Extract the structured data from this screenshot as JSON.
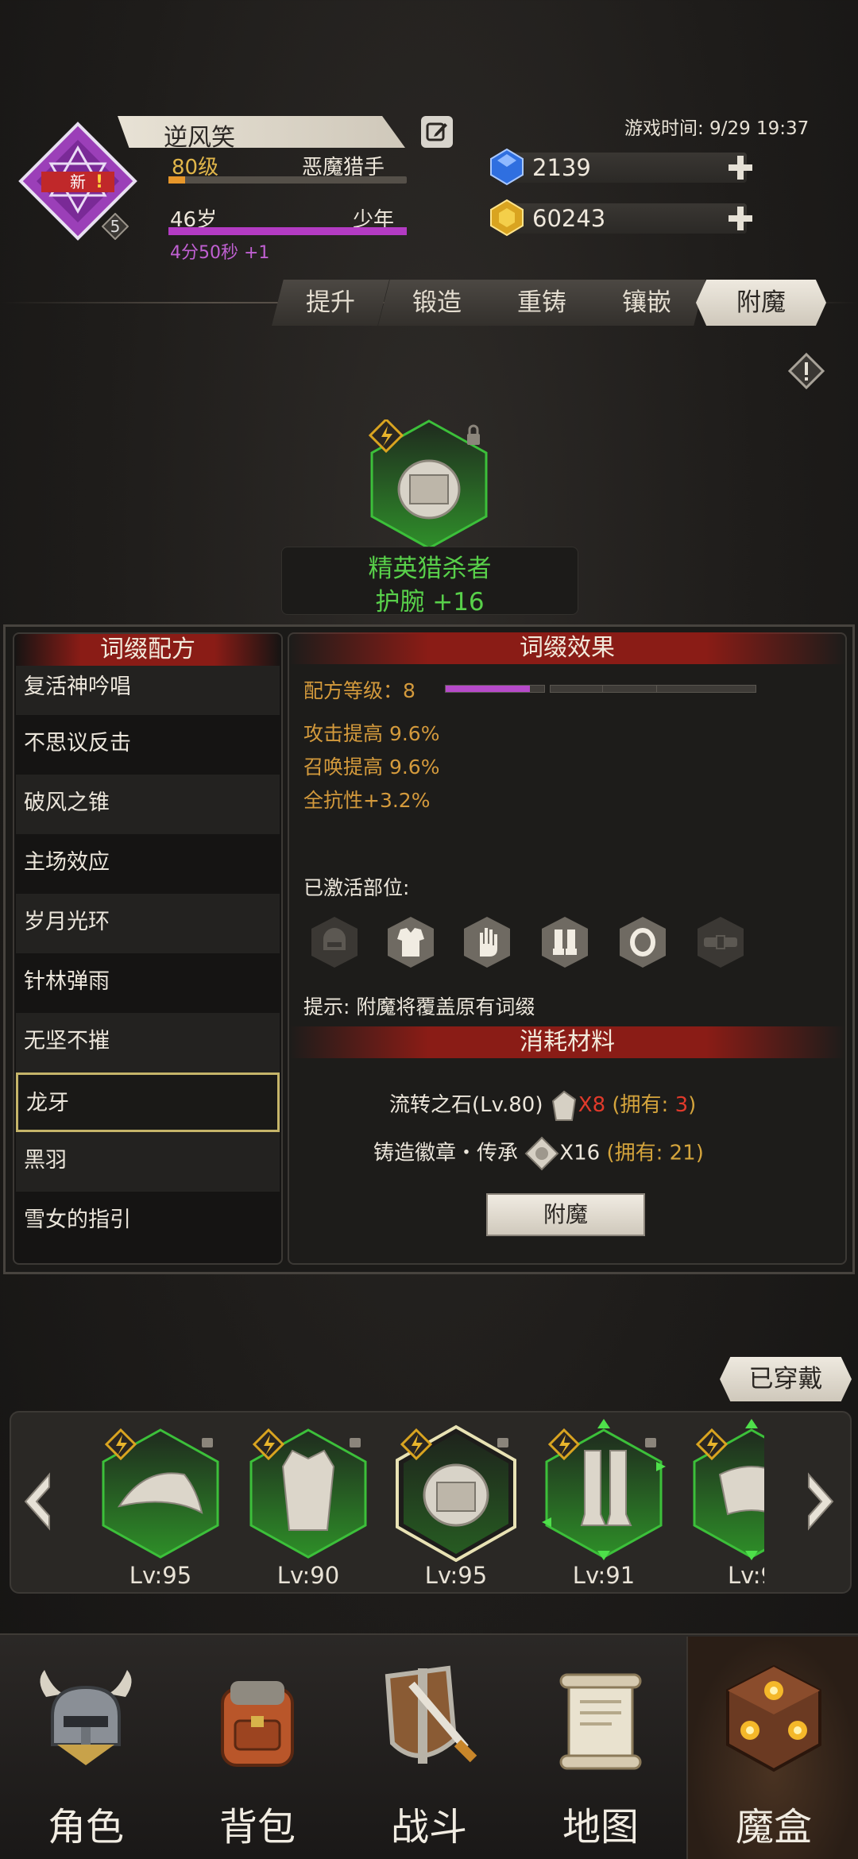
{
  "player": {
    "name": "逆风笑",
    "level": "80级",
    "class": "恶魔猎手",
    "age": "46岁",
    "stage": "少年",
    "timer": "4分50秒 +1",
    "badge_new": "新",
    "rank": "5",
    "level_progress": 0.07,
    "age_progress": 1.0
  },
  "game_time": "游戏时间: 9/29 19:37",
  "currency": {
    "gems": "2139",
    "gold": "60243"
  },
  "tabs": [
    "提升",
    "锻造",
    "重铸",
    "镶嵌",
    "附魔"
  ],
  "active_tab": "附魔",
  "item": {
    "name": "精英猎杀者",
    "subtitle": "护腕 +16"
  },
  "recipes": {
    "title": "词缀配方",
    "items": [
      "复活神吟唱",
      "不思议反击",
      "破风之锥",
      "主场效应",
      "岁月光环",
      "针林弹雨",
      "无坚不摧",
      "龙牙",
      "黑羽",
      "雪女的指引"
    ],
    "selected": "龙牙"
  },
  "effects": {
    "title": "词缀效果",
    "recipe_level": "配方等级：8",
    "level_progress_segments": 1.6,
    "lines": [
      "攻击提高 9.6%",
      "召唤提高 9.6%",
      "全抗性+3.2%"
    ],
    "active_label": "已激活部位:",
    "slots": [
      "helmet-icon",
      "armor-icon",
      "glove-icon",
      "boots-icon",
      "ring-icon",
      "belt-icon"
    ],
    "hint": "提示: 附魔将覆盖原有词缀"
  },
  "materials": {
    "title": "消耗材料",
    "row1": {
      "name": "流转之石(Lv.80)",
      "qty": "X8",
      "own_pre": "(拥有: ",
      "own_val": "3",
      "own_post": ")"
    },
    "row2": {
      "name": "铸造徽章・传承",
      "qty": "X16",
      "own": "(拥有: 21)"
    },
    "button": "附魔"
  },
  "equipped": {
    "tag": "已穿戴",
    "items": [
      {
        "lv": "Lv:95",
        "icon": "hat-icon"
      },
      {
        "lv": "Lv:90",
        "icon": "robe-icon"
      },
      {
        "lv": "Lv:95",
        "icon": "bracer-icon"
      },
      {
        "lv": "Lv:91",
        "icon": "greaves-icon"
      },
      {
        "lv": "Lv:9",
        "icon": "belt-item-icon"
      }
    ]
  },
  "nav": [
    "角色",
    "背包",
    "战斗",
    "地图",
    "魔盒"
  ],
  "active_nav": "魔盒",
  "colors": {
    "accent_red": "#8a1c16",
    "green": "#58d04a",
    "gold": "#d49a3c",
    "purple": "#b33bc3"
  }
}
